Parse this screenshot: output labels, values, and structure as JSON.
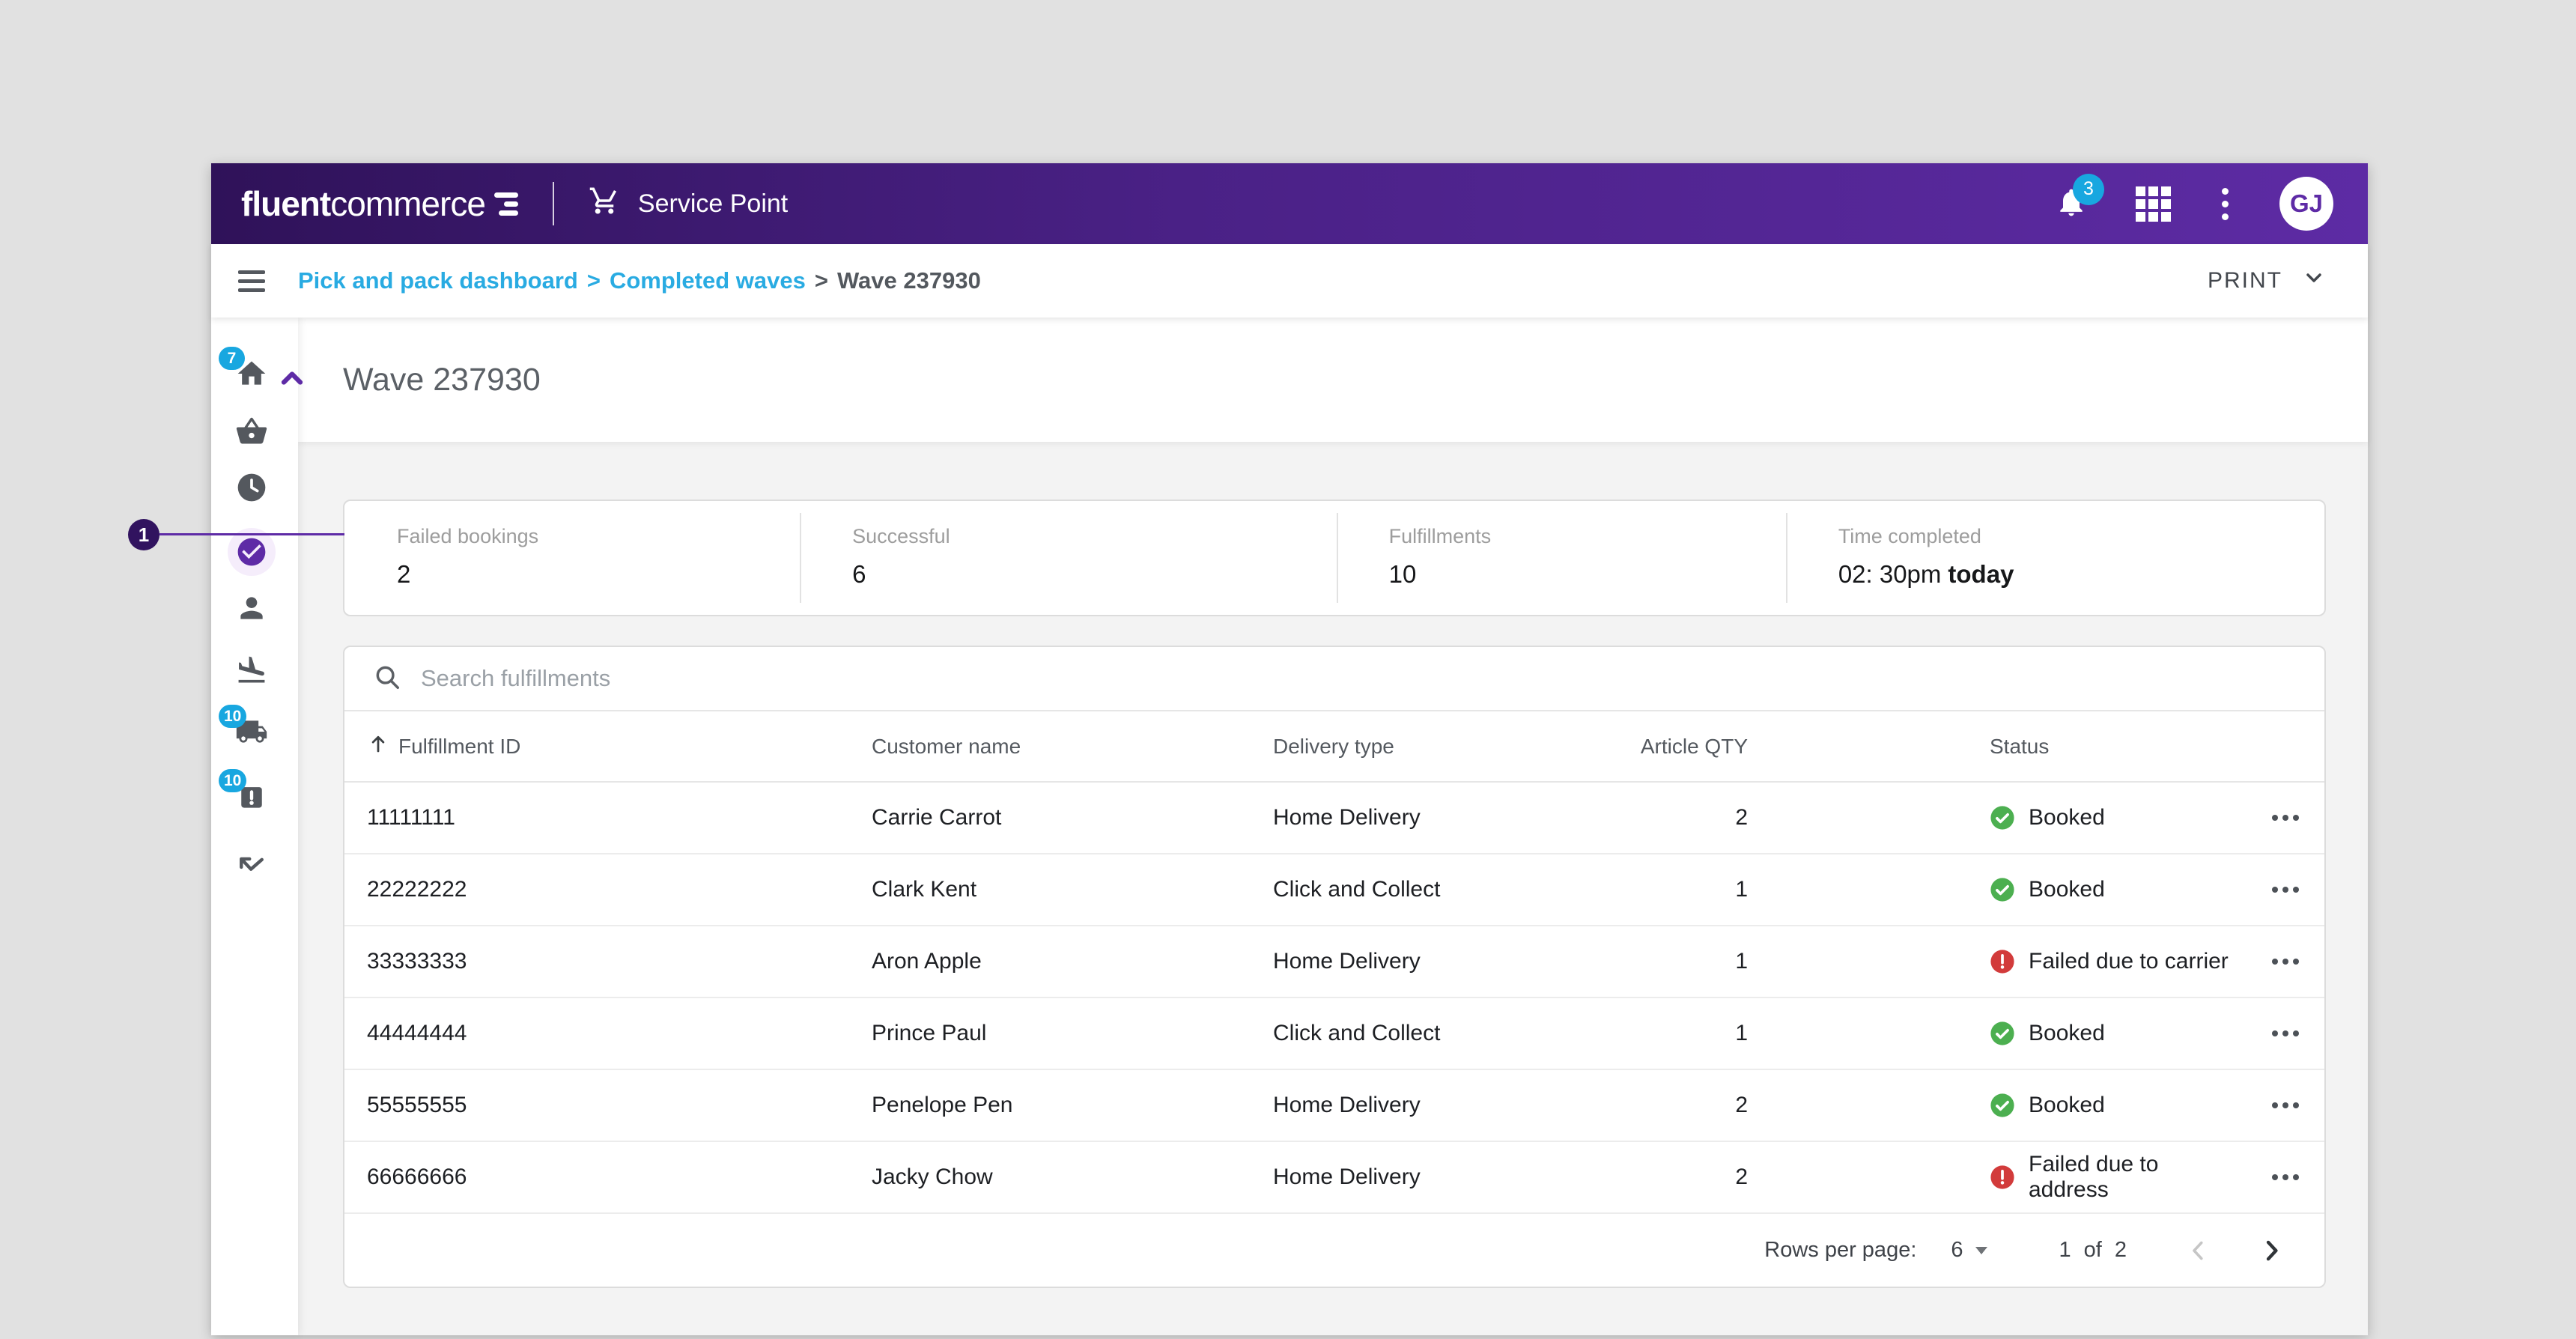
{
  "header": {
    "brand_bold": "fluent",
    "brand_light": "commerce",
    "app_name": "Service Point",
    "notification_count": "3",
    "avatar_initials": "GJ"
  },
  "breadcrumb": {
    "link1": "Pick and pack dashboard",
    "sep1": ">",
    "link2": "Completed waves",
    "sep2": ">",
    "current": "Wave 237930",
    "print_label": "PRINT"
  },
  "page": {
    "title": "Wave 237930"
  },
  "annotation": {
    "number": "1"
  },
  "sidebar": {
    "items": [
      {
        "icon": "home-icon",
        "badge": "7",
        "expanded": true
      },
      {
        "icon": "basket-icon"
      },
      {
        "icon": "clock-icon"
      },
      {
        "icon": "check-circle-icon",
        "active": true
      },
      {
        "icon": "person-icon"
      },
      {
        "icon": "flight-landing-icon"
      },
      {
        "icon": "truck-icon",
        "badge": "10"
      },
      {
        "icon": "package-alert-icon",
        "badge": "10"
      },
      {
        "icon": "arrow-check-icon"
      }
    ]
  },
  "stats": [
    {
      "label": "Failed bookings",
      "value": "2"
    },
    {
      "label": "Successful",
      "value": "6"
    },
    {
      "label": "Fulfillments",
      "value": "10"
    },
    {
      "label": "Time completed",
      "value": "02: 30pm",
      "value_bold": "today"
    }
  ],
  "search": {
    "placeholder": "Search fulfillments"
  },
  "table": {
    "columns": {
      "id": "Fulfillment ID",
      "customer": "Customer name",
      "delivery": "Delivery type",
      "qty": "Article QTY",
      "status": "Status"
    },
    "sorted_column": "Fulfillment ID",
    "sort_direction": "asc",
    "rows": [
      {
        "id": "11111111",
        "customer": "Carrie Carrot",
        "delivery": "Home Delivery",
        "qty": "2",
        "status": "Booked",
        "status_type": "success"
      },
      {
        "id": "22222222",
        "customer": "Clark Kent",
        "delivery": "Click and Collect",
        "qty": "1",
        "status": "Booked",
        "status_type": "success"
      },
      {
        "id": "33333333",
        "customer": "Aron Apple",
        "delivery": "Home Delivery",
        "qty": "1",
        "status": "Failed due to carrier",
        "status_type": "error"
      },
      {
        "id": "44444444",
        "customer": "Prince Paul",
        "delivery": "Click and Collect",
        "qty": "1",
        "status": "Booked",
        "status_type": "success"
      },
      {
        "id": "55555555",
        "customer": "Penelope Pen",
        "delivery": "Home Delivery",
        "qty": "2",
        "status": "Booked",
        "status_type": "success"
      },
      {
        "id": "66666666",
        "customer": "Jacky Chow",
        "delivery": "Home Delivery",
        "qty": "2",
        "status": "Failed due to address",
        "status_type": "error"
      }
    ],
    "pagination": {
      "rows_per_page_label": "Rows per page:",
      "rows_per_page": "6",
      "page": "1",
      "of_label": "of",
      "total_pages": "2"
    }
  },
  "colors": {
    "brand_purple": "#5d2ba4",
    "brand_purple_dark": "#2f1259",
    "link_blue": "#29abe2",
    "badge_cyan": "#18a7e0",
    "success_green": "#4caf50",
    "error_red": "#d23b3b",
    "annotation_purple": "#5e2ba6"
  }
}
